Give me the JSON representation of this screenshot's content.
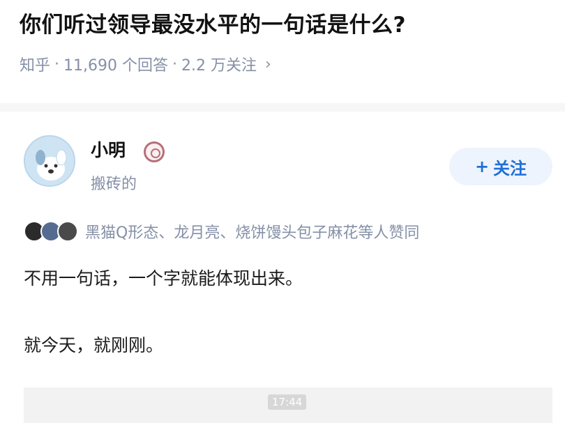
{
  "question": {
    "title": "你们听过领导最没水平的一句话是什么?",
    "source": "知乎",
    "answers_count": "11,690 个回答",
    "followers": "2.2 万关注",
    "chevron": "›",
    "separator": "·"
  },
  "answer": {
    "author_name": "小明",
    "author_headline": "搬砖的",
    "follow_label": "关注",
    "follow_plus": "+",
    "voters_text": "黑猫Q形态、龙月亮、烧饼馒头包子麻花等人赞同",
    "paragraphs": [
      "不用一句话，一个字就能体现出来。",
      "就今天，就刚刚。"
    ],
    "timestamp": "17:44"
  },
  "icons": {
    "avatar": "dog-avatar-icon",
    "badge": "badge-icon",
    "chevron": "chevron-right-icon"
  },
  "colors": {
    "accent": "#1e6fd9",
    "meta_gray": "#8590a6",
    "follow_bg": "#eef4fd",
    "badge": "#b47079"
  }
}
